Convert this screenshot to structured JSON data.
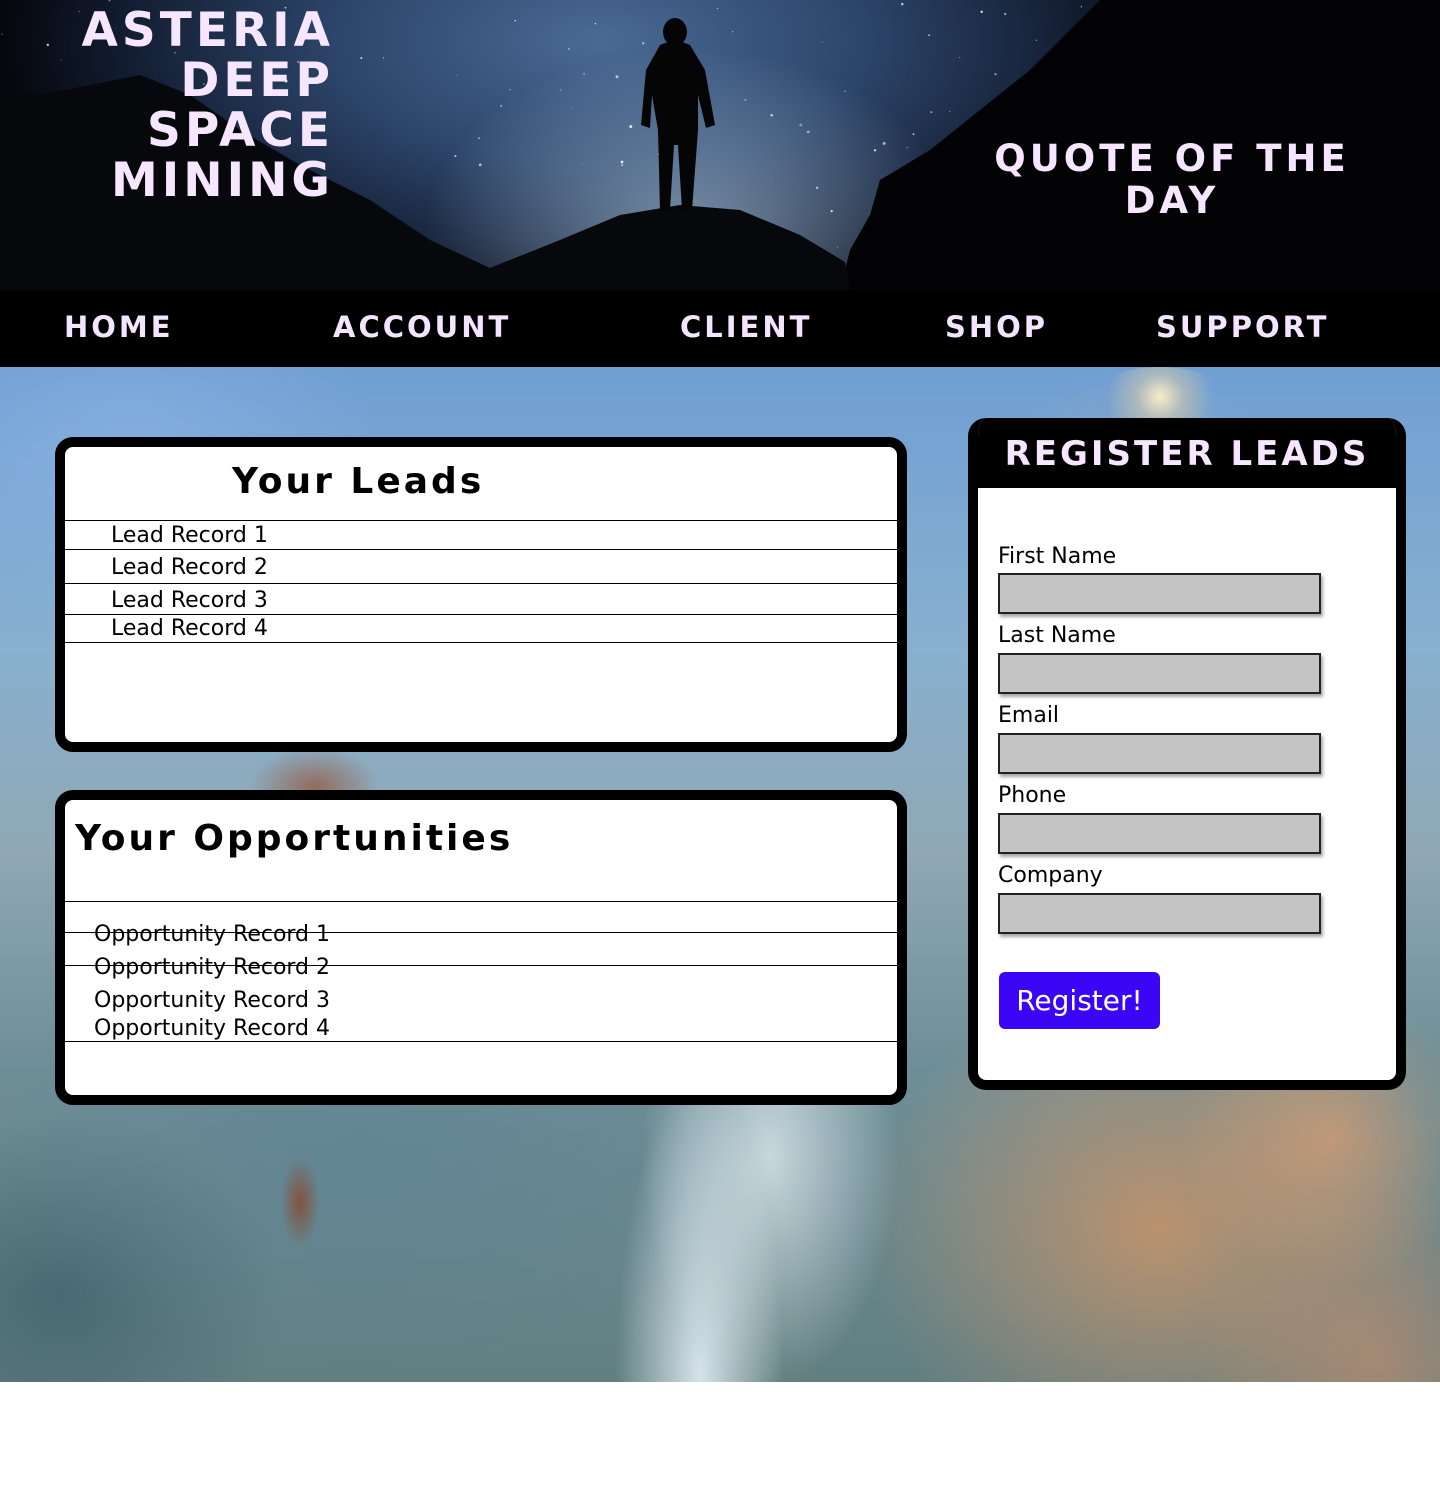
{
  "brand": {
    "line1": "Asteria",
    "line2": "Deep",
    "line3": "Space",
    "line4": "Mining"
  },
  "quote": {
    "heading": "Quote of the Day"
  },
  "nav": {
    "items": [
      {
        "label": "HOME"
      },
      {
        "label": "ACCOUNT"
      },
      {
        "label": "CLIENT"
      },
      {
        "label": "SHOP"
      },
      {
        "label": "SUPPORT"
      }
    ]
  },
  "leads": {
    "title": "Your Leads",
    "records": [
      "Lead Record 1",
      "Lead Record 2",
      "Lead Record 3",
      "Lead Record 4"
    ]
  },
  "opportunities": {
    "title": "Your Opportunities",
    "records": [
      "Opportunity Record 1",
      "Opportunity Record 2",
      "Opportunity Record 3",
      "Opportunity Record 4"
    ]
  },
  "register": {
    "title": "REGISTER LEADS",
    "fields": [
      {
        "label": "First Name",
        "value": ""
      },
      {
        "label": "Last Name",
        "value": ""
      },
      {
        "label": "Email",
        "value": ""
      },
      {
        "label": "Phone",
        "value": ""
      },
      {
        "label": "Company",
        "value": ""
      }
    ],
    "submit_label": "Register!",
    "button_color": "#3b06f6"
  },
  "colors": {
    "header_text": "#f6e6ff",
    "nav_bg": "#000000",
    "panel_border": "#000000"
  }
}
